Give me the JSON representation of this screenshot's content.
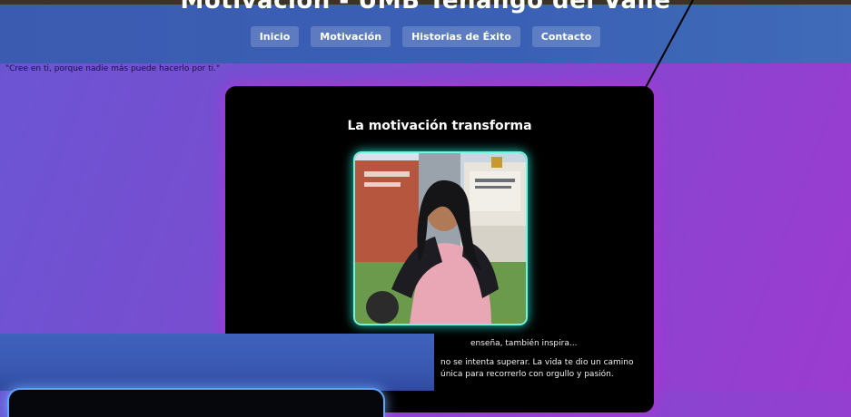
{
  "site": {
    "title": "Motivación - UMB Tenango del Valle"
  },
  "nav": {
    "items": [
      "Inicio",
      "Motivación",
      "Historias de Éxito",
      "Contacto"
    ]
  },
  "quote": "\"Cree en ti, porque nadie más puede hacerlo por ti.\"",
  "card": {
    "title": "La motivación transforma",
    "text1": "enseña, también inspira...",
    "text2": "no se intenta superar. La vida te dio un camino única para recorrerlo con orgullo y pasión."
  },
  "colors": {
    "page_gradient_start": "#6a55d2",
    "page_gradient_end": "#9b3bd0",
    "topbar": "#3b5bb0",
    "card_bg": "#000000",
    "card_glow": "#c828dc",
    "photo_border": "#6ff6e0"
  }
}
